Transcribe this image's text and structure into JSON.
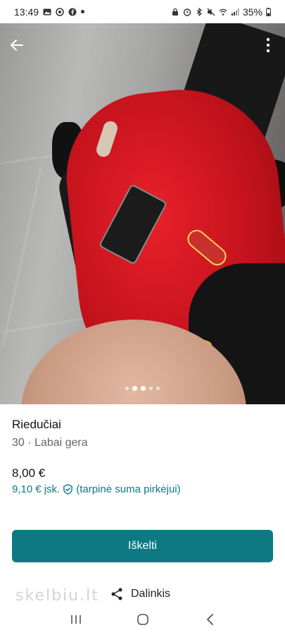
{
  "status_bar": {
    "time": "13:49",
    "battery": "35%"
  },
  "photo": {
    "pager_total": 5,
    "pager_active": 2
  },
  "listing": {
    "title": "Riedučiai",
    "subtitle": "30 · Labai gera",
    "price": "8,00 €",
    "total_price": "9,10 €",
    "total_incl": "įsk.",
    "total_note": "(tarpinė suma pirkėjui)"
  },
  "actions": {
    "boost_label": "Iškelti",
    "share_label": "Dalinkis",
    "watermark": "skelbiu.lt"
  },
  "colors": {
    "accent": "#0d7a83"
  }
}
